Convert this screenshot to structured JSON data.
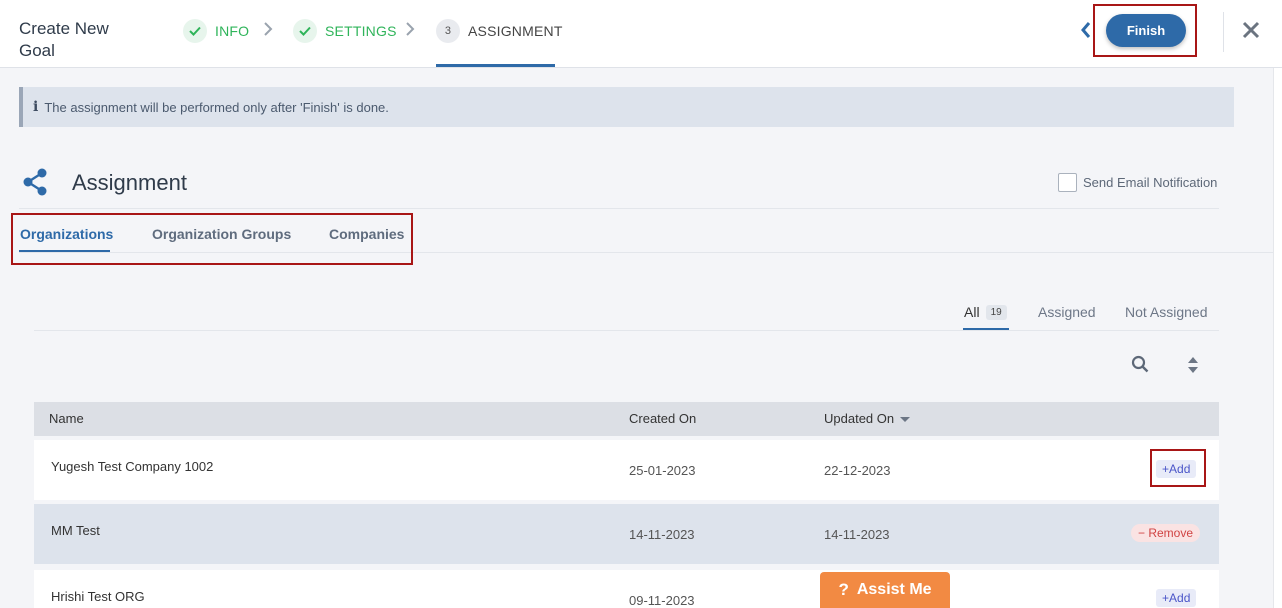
{
  "header": {
    "title": "Create New Goal",
    "steps": [
      {
        "label": "INFO",
        "state": "done"
      },
      {
        "label": "SETTINGS",
        "state": "done"
      },
      {
        "label": "ASSIGNMENT",
        "state": "active",
        "number": "3"
      }
    ],
    "finish_label": "Finish"
  },
  "info_banner": {
    "text": "The assignment will be performed only after 'Finish' is done."
  },
  "section": {
    "title": "Assignment",
    "email_notification_label": "Send Email Notification",
    "email_notification_checked": false
  },
  "tabs": [
    {
      "label": "Organizations",
      "active": true
    },
    {
      "label": "Organization Groups",
      "active": false
    },
    {
      "label": "Companies",
      "active": false
    }
  ],
  "filters": {
    "all_label": "All",
    "all_count": "19",
    "assigned_label": "Assigned",
    "not_assigned_label": "Not Assigned"
  },
  "table": {
    "columns": {
      "name": "Name",
      "created": "Created On",
      "updated": "Updated On"
    },
    "rows": [
      {
        "name": "Yugesh Test Company 1002",
        "created": "25-01-2023",
        "updated": "22-12-2023",
        "action": "Add"
      },
      {
        "name": "MM Test",
        "created": "14-11-2023",
        "updated": "14-11-2023",
        "action": "Remove"
      },
      {
        "name": "Hrishi Test ORG",
        "created": "09-11-2023",
        "updated": "",
        "action": "Add"
      }
    ]
  },
  "assist": {
    "label": "Assist Me"
  },
  "colors": {
    "accent": "#2e6aa8",
    "done": "#2fb45a",
    "highlight": "#a81616",
    "assist": "#f28a43"
  }
}
